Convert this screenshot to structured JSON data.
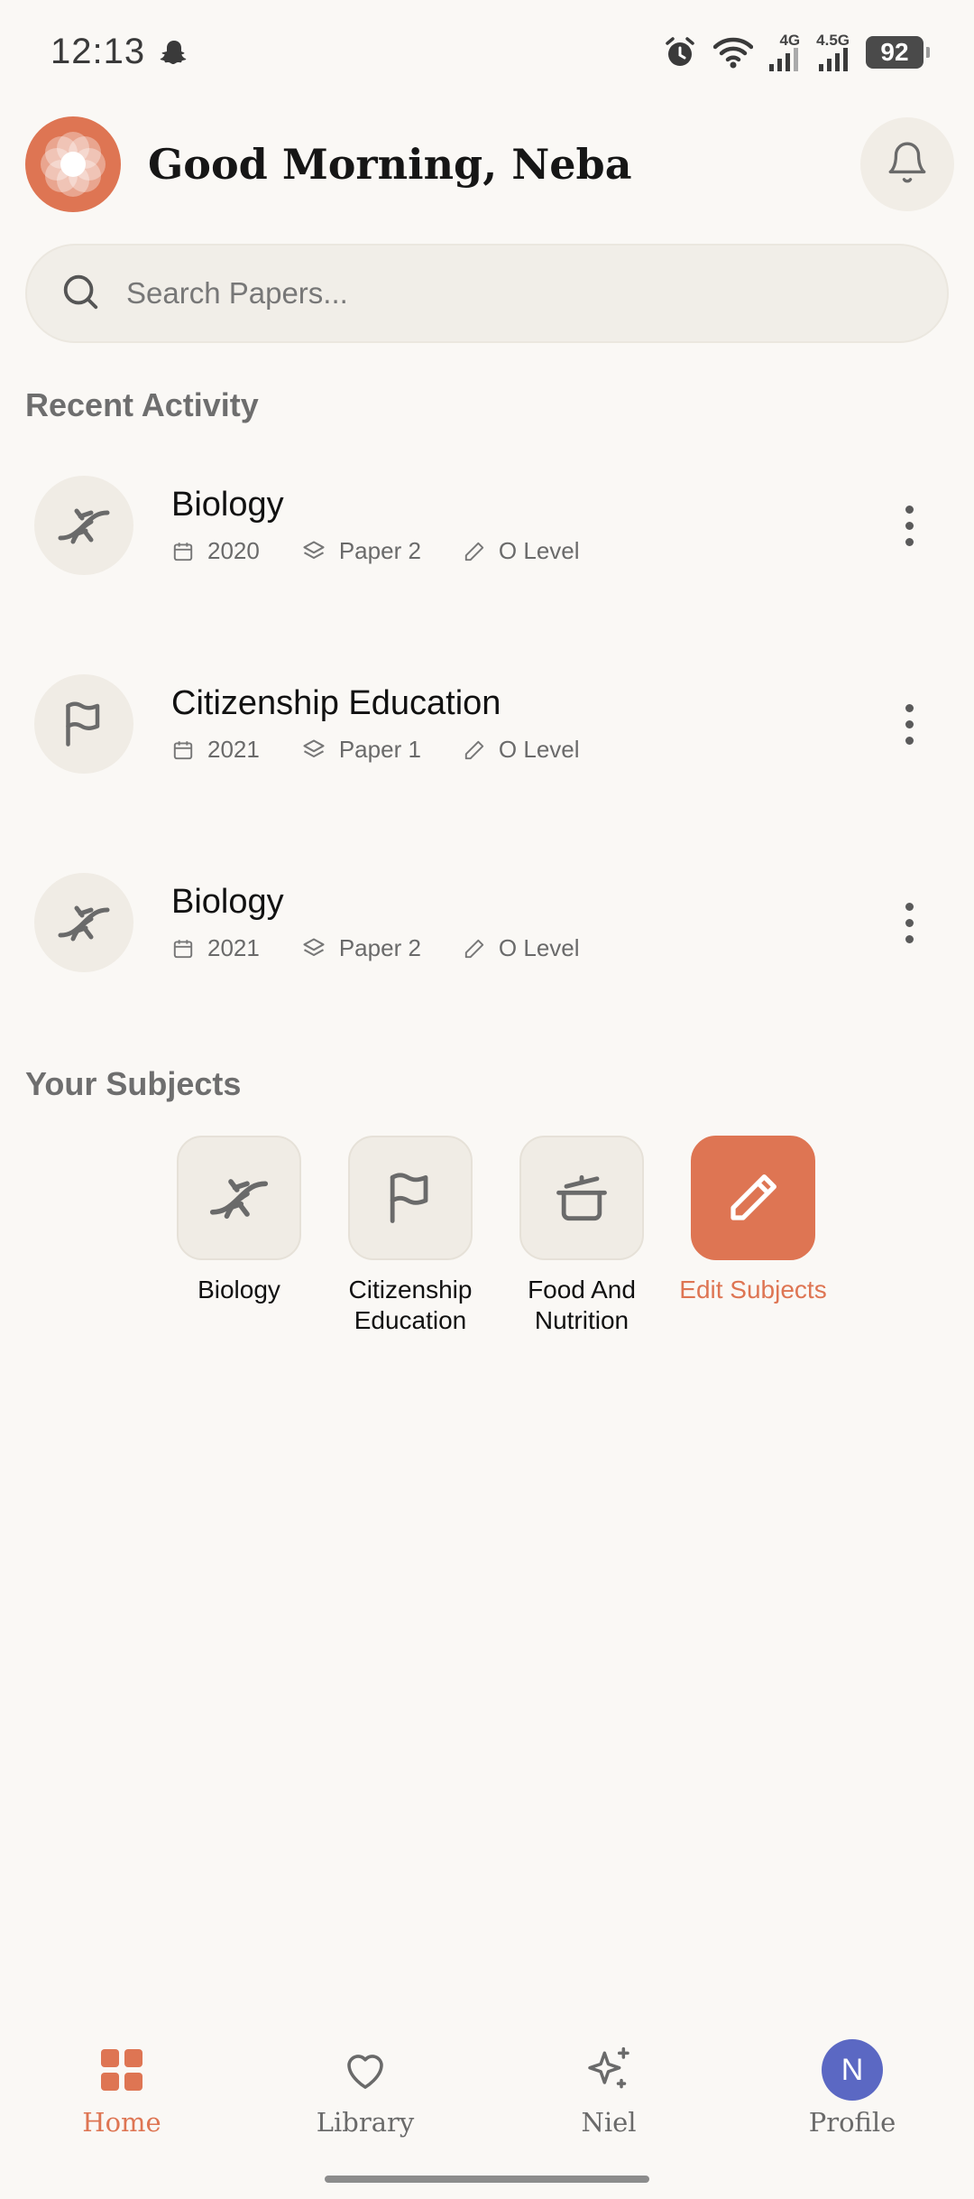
{
  "status_bar": {
    "time": "12:13",
    "network_1": "4G",
    "network_2": "4.5G",
    "battery": "92"
  },
  "header": {
    "greeting": "Good Morning, Neba"
  },
  "search": {
    "placeholder": "Search Papers..."
  },
  "recent_activity": {
    "title": "Recent Activity",
    "items": [
      {
        "subject": "Biology",
        "icon": "dna-icon",
        "year": "2020",
        "paper": "Paper 2",
        "level": "O Level"
      },
      {
        "subject": "Citizenship Education",
        "icon": "flag-icon",
        "year": "2021",
        "paper": "Paper 1",
        "level": "O Level"
      },
      {
        "subject": "Biology",
        "icon": "dna-icon",
        "year": "2021",
        "paper": "Paper 2",
        "level": "O Level"
      }
    ]
  },
  "subjects": {
    "title": "Your Subjects",
    "items": [
      {
        "label": "Biology",
        "icon": "dna-icon"
      },
      {
        "label": "Citizenship Education",
        "icon": "flag-icon"
      },
      {
        "label": "Food And Nutrition",
        "icon": "cooking-pot-icon"
      },
      {
        "label": "Edit Subjects",
        "icon": "pencil-icon"
      }
    ]
  },
  "nav": {
    "home": "Home",
    "library": "Library",
    "niel": "Niel",
    "profile": "Profile",
    "avatar_initial": "N"
  },
  "colors": {
    "accent": "#de7553",
    "background": "#faf8f5",
    "avatar": "#5b68c3"
  }
}
